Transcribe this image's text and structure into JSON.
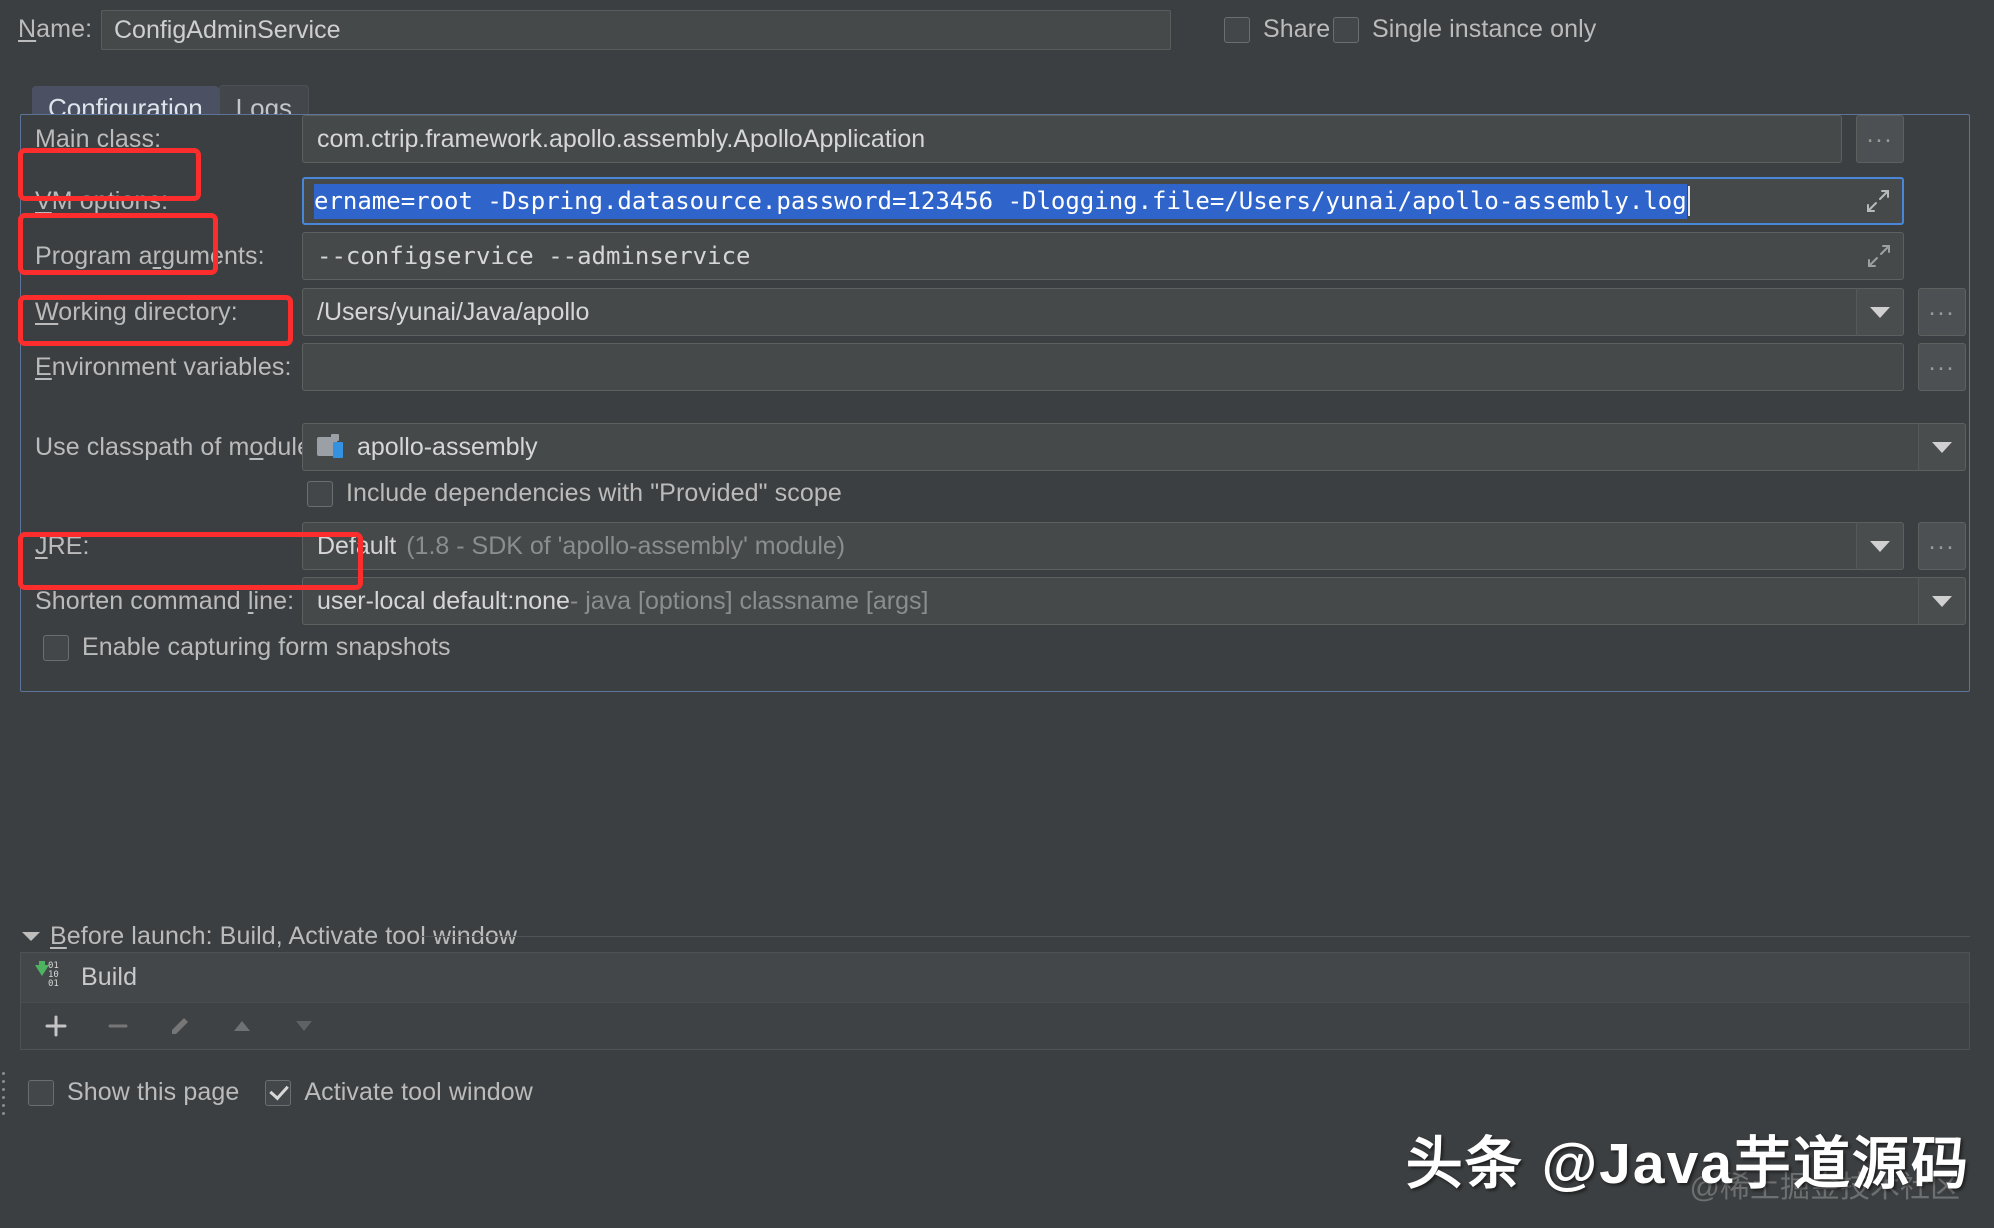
{
  "header": {
    "name_label": "Name:",
    "name_label_mnemonic": "N",
    "name_value": "ConfigAdminService",
    "share_label": "Share",
    "share_checked": false,
    "single_instance_label": "Single instance only",
    "single_instance_checked": false
  },
  "tabs": [
    {
      "label": "Configuration",
      "active": true
    },
    {
      "label": "Logs",
      "active": false
    }
  ],
  "form": {
    "main_class": {
      "label": "Main class:",
      "label_pre": "Main ",
      "label_mnemonic": "c",
      "label_post": "lass:",
      "value": "com.ctrip.framework.apollo.assembly.ApolloApplication",
      "browse_label": "...",
      "highlighted": true
    },
    "vm_options": {
      "label": "VM options:",
      "label_pre": "",
      "label_mnemonic": "V",
      "label_post": "M options:",
      "value": "ername=root -Dspring.datasource.password=123456 -Dlogging.file=/Users/yunai/apollo-assembly.log",
      "selected": true,
      "focused": true,
      "highlighted": true
    },
    "program_arguments": {
      "label": "Program arguments:",
      "label_pre": "Program a",
      "label_mnemonic": "r",
      "label_post": "guments:",
      "value": "--configservice --adminservice",
      "highlighted": true
    },
    "working_directory": {
      "label": "Working directory:",
      "label_pre": "",
      "label_mnemonic": "W",
      "label_post": "orking directory:",
      "value": "/Users/yunai/Java/apollo",
      "browse_label": "...",
      "highlighted": false
    },
    "environment_variables": {
      "label": "Environment variables:",
      "label_pre": "",
      "label_mnemonic": "E",
      "label_post": "nvironment variables:",
      "value": "",
      "browse_label": "...",
      "highlighted": false
    },
    "use_classpath_of_module": {
      "label": "Use classpath of module:",
      "label_pre": "Use classpath of m",
      "label_mnemonic": "o",
      "label_post": "dule:",
      "value": "apollo-assembly",
      "icon": "module-icon",
      "highlighted": true
    },
    "include_provided": {
      "label": "Include dependencies with \"Provided\" scope",
      "checked": false
    },
    "jre": {
      "label": "JRE:",
      "label_pre": "",
      "label_mnemonic": "J",
      "label_post": "RE:",
      "value_strong": "Default",
      "value_dim": "(1.8 - SDK of 'apollo-assembly' module)",
      "browse_label": "...",
      "highlighted": false
    },
    "shorten_command_line": {
      "label": "Shorten command line:",
      "label_pre": "Shorten command ",
      "label_mnemonic": "l",
      "label_post": "ine:",
      "value_pre": "user-local default: ",
      "value_strong": "none",
      "value_post": " - java [options] classname [args]",
      "highlighted": false
    },
    "enable_capturing": {
      "label": "Enable capturing form snapshots",
      "checked": false
    }
  },
  "before_launch": {
    "header": "Before launch: Build, Activate tool window",
    "header_pre": "",
    "header_mnemonic": "B",
    "header_post": "efore launch: Build, Activate tool window",
    "tasks": [
      {
        "label": "Build",
        "icon": "build-icon"
      }
    ],
    "toolbar": [
      {
        "name": "add-task-button",
        "glyph": "+",
        "enabled": true
      },
      {
        "name": "remove-task-button",
        "glyph": "–",
        "enabled": false
      },
      {
        "name": "edit-task-button",
        "glyph": "pencil-icon",
        "enabled": false
      },
      {
        "name": "move-up-button",
        "glyph": "triangle-up-icon",
        "enabled": false
      },
      {
        "name": "move-down-button",
        "glyph": "triangle-down-icon",
        "enabled": false
      }
    ]
  },
  "footer": {
    "show_page_label": "Show this page",
    "show_page_checked": false,
    "activate_tool_window_label": "Activate tool window",
    "activate_tool_window_checked": true
  },
  "watermark": {
    "text": "头条 @Java芋道源码",
    "subtext": "@稀土掘金技术社区"
  },
  "colors": {
    "background": "#3c3f41",
    "field_background": "#45494a",
    "selection_blue": "#2f65ca",
    "annotation_red": "#fb2d2d",
    "panel_border": "#5d7499",
    "tab_active": "#4b5163",
    "build_green": "#4eb360",
    "module_blue": "#3592e0"
  }
}
